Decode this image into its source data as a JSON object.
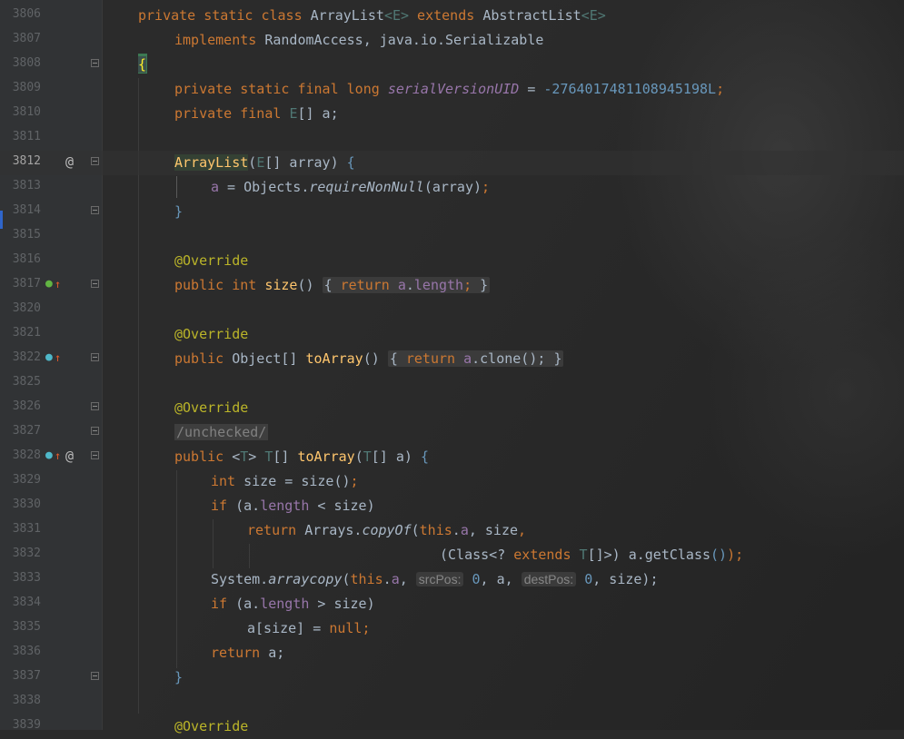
{
  "editor": {
    "lines": [
      {
        "num": "3806",
        "code": "    private static class ArrayList<E> extends AbstractList<E>"
      },
      {
        "num": "3807",
        "code": "        implements RandomAccess, java.io.Serializable"
      },
      {
        "num": "3808",
        "code": "    {"
      },
      {
        "num": "3809",
        "code": "        private static final long serialVersionUID = -2764017481108945198L;"
      },
      {
        "num": "3810",
        "code": "        private final E[] a;"
      },
      {
        "num": "3811",
        "code": ""
      },
      {
        "num": "3812",
        "code": "        ArrayList(E[] array) {"
      },
      {
        "num": "3813",
        "code": "            a = Objects.requireNonNull(array);"
      },
      {
        "num": "3814",
        "code": "        }"
      },
      {
        "num": "3815",
        "code": ""
      },
      {
        "num": "3816",
        "code": "        @Override"
      },
      {
        "num": "3817",
        "code": "        public int size() { return a.length; }"
      },
      {
        "num": "3820",
        "code": ""
      },
      {
        "num": "3821",
        "code": "        @Override"
      },
      {
        "num": "3822",
        "code": "        public Object[] toArray() { return a.clone(); }"
      },
      {
        "num": "3825",
        "code": ""
      },
      {
        "num": "3826",
        "code": "        @Override"
      },
      {
        "num": "3827",
        "code": "        /unchecked/"
      },
      {
        "num": "3828",
        "code": "        public <T> T[] toArray(T[] a) {"
      },
      {
        "num": "3829",
        "code": "            int size = size();"
      },
      {
        "num": "3830",
        "code": "            if (a.length < size)"
      },
      {
        "num": "3831",
        "code": "                return Arrays.copyOf(this.a, size,"
      },
      {
        "num": "3832",
        "code": "                                     (Class<? extends T[]>) a.getClass());"
      },
      {
        "num": "3833",
        "code": "            System.arraycopy(this.a, srcPos: 0, a, destPos: 0, size);"
      },
      {
        "num": "3834",
        "code": "            if (a.length > size)"
      },
      {
        "num": "3835",
        "code": "                a[size] = null;"
      },
      {
        "num": "3836",
        "code": "            return a;"
      },
      {
        "num": "3837",
        "code": "        }"
      },
      {
        "num": "3838",
        "code": ""
      },
      {
        "num": "3839",
        "code": "        @Override"
      }
    ],
    "tokens": {
      "t3806": [
        "private static class ",
        "ArrayList",
        "<E>",
        " extends ",
        "AbstractList",
        "<E>"
      ],
      "t3807": [
        "implements ",
        "RandomAccess, java.io.Serializable"
      ],
      "t3808": [
        "{"
      ],
      "t3809": [
        "private static final long ",
        "serialVersionUID",
        " = ",
        "-2764017481108945198L",
        ";"
      ],
      "t3810": [
        "private final ",
        "E",
        "[] a;"
      ],
      "t3812": [
        "ArrayList",
        "(",
        "E",
        "[] array) ",
        "{"
      ],
      "t3813": [
        "a",
        " = Objects.",
        "requireNonNull",
        "(array)",
        ";"
      ],
      "t3814": [
        "}"
      ],
      "t3816": [
        "@Override"
      ],
      "t3817": [
        "public int ",
        "size",
        "() ",
        "{ ",
        "return ",
        "a",
        ".",
        "length",
        "; ",
        "}"
      ],
      "t3821": [
        "@Override"
      ],
      "t3822": [
        "public ",
        "Object[] ",
        "toArray",
        "() ",
        "{ ",
        "return ",
        "a",
        ".clone(); ",
        "}"
      ],
      "t3826": [
        "@Override"
      ],
      "t3827": [
        "/unchecked/"
      ],
      "t3828": [
        "public ",
        "<",
        "T",
        ">",
        " T",
        "[] ",
        "toArray",
        "(",
        "T",
        "[] a) ",
        "{"
      ],
      "t3829": [
        "int ",
        "size = size()",
        ";"
      ],
      "t3830": [
        "if ",
        "(a.",
        "length",
        " < size)"
      ],
      "t3831": [
        "return ",
        "Arrays.",
        "copyOf",
        "(",
        "this",
        ".",
        "a",
        ", size",
        ","
      ],
      "t3832": [
        "(Class<? ",
        "extends ",
        "T",
        "[]>) a.getClass",
        "()",
        ");"
      ],
      "t3833": [
        "System.",
        "arraycopy",
        "(",
        "this",
        ".",
        "a",
        ", ",
        "srcPos:",
        " 0",
        ", a, ",
        "destPos:",
        " 0",
        ", size);"
      ],
      "t3834": [
        "if ",
        "(a.",
        "length",
        " > size)"
      ],
      "t3835": [
        "a[size] = ",
        "null",
        ";"
      ],
      "t3836": [
        "return ",
        "a;"
      ],
      "t3837": [
        "}"
      ],
      "t3839": [
        "@Override"
      ]
    }
  },
  "colors": {
    "background": "#2b2b2b",
    "gutter": "#313335",
    "keyword": "#cc7832",
    "number": "#6897bb",
    "field": "#9876aa",
    "method": "#ffc66d",
    "annotation": "#bbb529",
    "text": "#a9b7c6"
  }
}
